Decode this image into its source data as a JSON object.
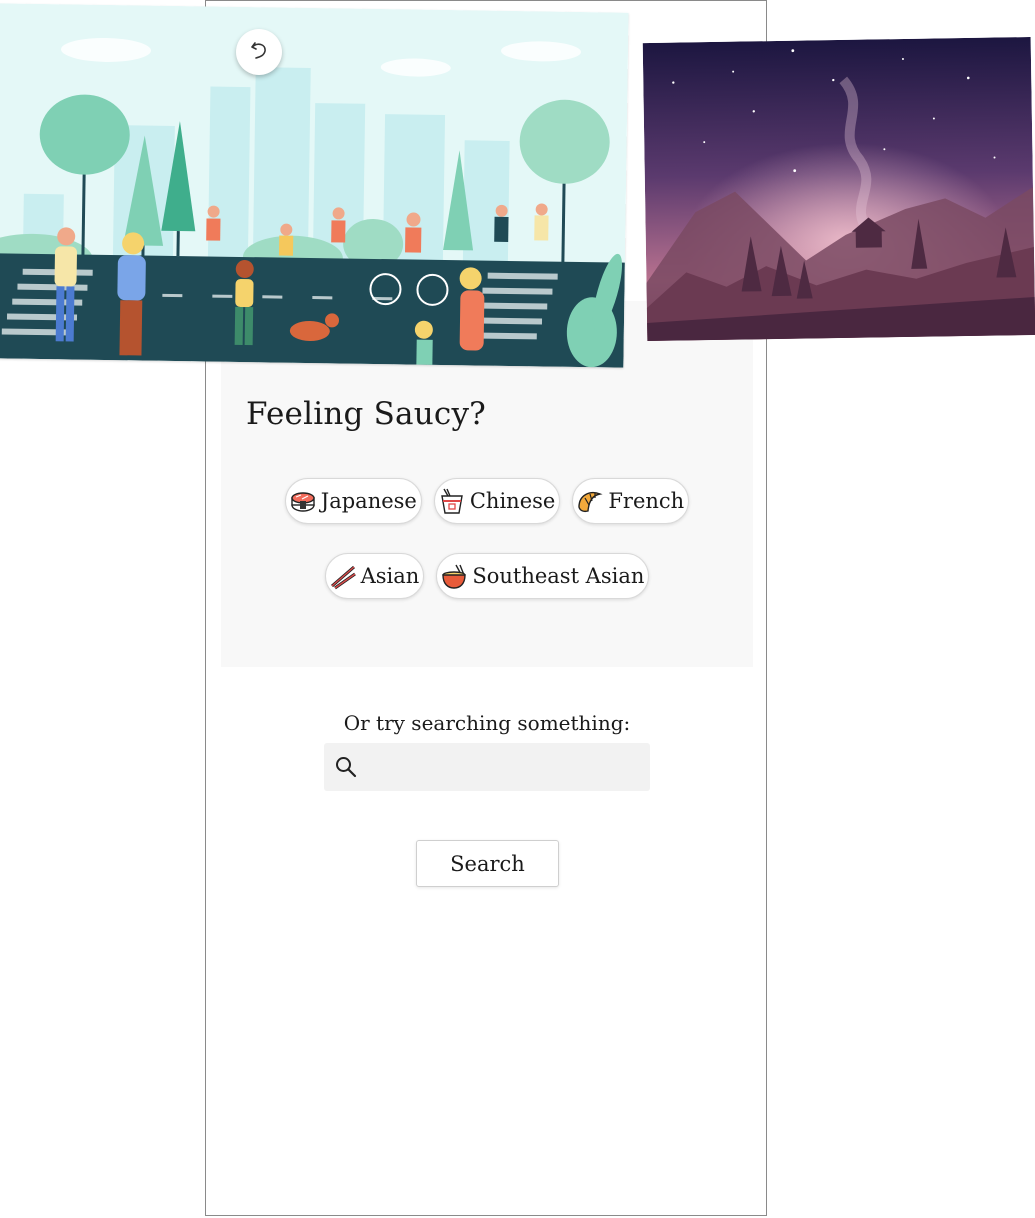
{
  "card": {
    "title": "Feeling Saucy?",
    "chips_row1": [
      {
        "label": "Japanese",
        "icon": "sushi-icon"
      },
      {
        "label": "Chinese",
        "icon": "takeout-box-icon"
      },
      {
        "label": "French",
        "icon": "croissant-icon"
      }
    ],
    "chips_row2": [
      {
        "label": "Asian",
        "icon": "chopsticks-icon"
      },
      {
        "label": "Southeast Asian",
        "icon": "noodle-bowl-icon"
      }
    ]
  },
  "search": {
    "prompt": "Or try searching something:",
    "placeholder": "",
    "value": "",
    "button_label": "Search"
  },
  "images": {
    "city": {
      "name": "city-park-illustration",
      "sky": "#e4f8f7",
      "road": "#1f4a55"
    },
    "night": {
      "name": "night-mountain-illustration",
      "top": "#1c1640",
      "glow": "#d99ab0"
    }
  },
  "controls": {
    "undo_icon": "undo-icon"
  }
}
